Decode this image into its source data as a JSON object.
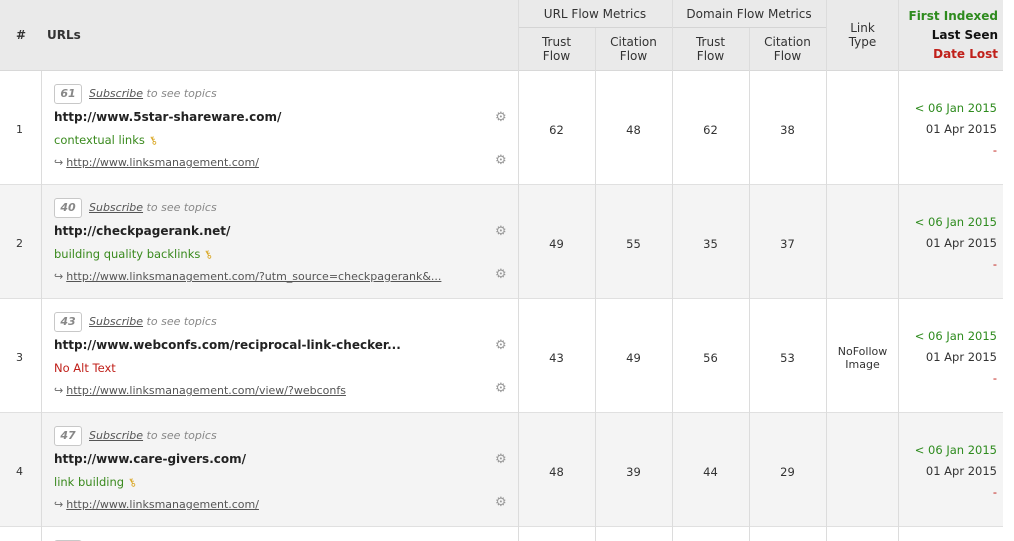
{
  "header": {
    "hash": "#",
    "urls": "URLs",
    "url_flow_metrics": "URL Flow Metrics",
    "domain_flow_metrics": "Domain Flow Metrics",
    "trust_flow": "Trust Flow",
    "citation_flow": "Citation Flow",
    "link_type": "Link Type",
    "first_indexed": "First Indexed",
    "last_seen": "Last Seen",
    "date_lost": "Date Lost"
  },
  "subscribe": {
    "link": "Subscribe",
    "suffix": "to see topics"
  },
  "colors": {
    "first_indexed": "#2e8b1e",
    "date_lost": "#c0201a",
    "anchor_green": "#3a8a1e",
    "anchor_red": "#c0201a",
    "header_bg": "#eaeaea"
  },
  "icons": {
    "gear": "gear-icon",
    "key": "key-icon",
    "arrow": "return-arrow-icon"
  },
  "rows": [
    {
      "num": "1",
      "topic_score": "61",
      "url": "http://www.5star-shareware.com/",
      "anchor": "contextual links",
      "anchor_type": "green",
      "target": "http://www.linksmanagement.com/",
      "url_tf": "62",
      "url_cf": "48",
      "dom_tf": "62",
      "dom_cf": "38",
      "link_type": "",
      "first_indexed": "< 06 Jan 2015",
      "last_seen": "01 Apr 2015",
      "date_lost": "-"
    },
    {
      "num": "2",
      "topic_score": "40",
      "url": "http://checkpagerank.net/",
      "anchor": "building quality backlinks",
      "anchor_type": "green",
      "target": "http://www.linksmanagement.com/?utm_source=checkpagerank&...",
      "url_tf": "49",
      "url_cf": "55",
      "dom_tf": "35",
      "dom_cf": "37",
      "link_type": "",
      "first_indexed": "< 06 Jan 2015",
      "last_seen": "01 Apr 2015",
      "date_lost": "-"
    },
    {
      "num": "3",
      "topic_score": "43",
      "url": "http://www.webconfs.com/reciprocal-link-checker...",
      "anchor": "No Alt Text",
      "anchor_type": "red",
      "target": "http://www.linksmanagement.com/view/?webconfs",
      "url_tf": "43",
      "url_cf": "49",
      "dom_tf": "56",
      "dom_cf": "53",
      "link_type": "NoFollow Image",
      "first_indexed": "< 06 Jan 2015",
      "last_seen": "01 Apr 2015",
      "date_lost": "-"
    },
    {
      "num": "4",
      "topic_score": "47",
      "url": "http://www.care-givers.com/",
      "anchor": "link building",
      "anchor_type": "green",
      "target": "http://www.linksmanagement.com/",
      "url_tf": "48",
      "url_cf": "39",
      "dom_tf": "44",
      "dom_cf": "29",
      "link_type": "",
      "first_indexed": "< 06 Jan 2015",
      "last_seen": "01 Apr 2015",
      "date_lost": "-"
    }
  ]
}
